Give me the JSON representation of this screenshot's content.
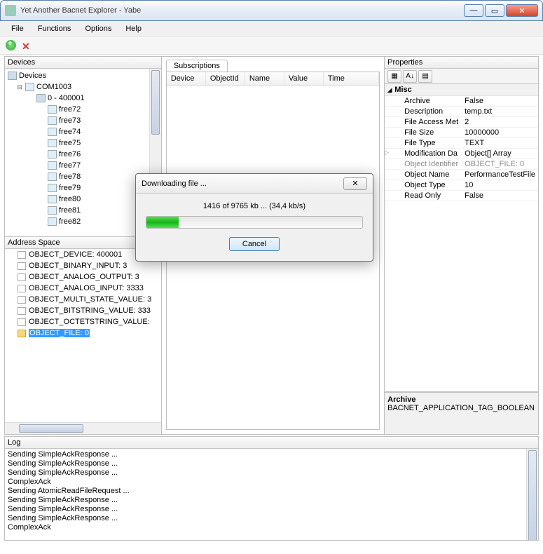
{
  "window": {
    "title": "Yet Another Bacnet Explorer - Yabe"
  },
  "menu": {
    "file": "File",
    "functions": "Functions",
    "options": "Options",
    "help": "Help"
  },
  "panels": {
    "devices": "Devices",
    "address_space": "Address Space",
    "subscriptions": "Subscriptions",
    "properties": "Properties",
    "log": "Log"
  },
  "device_tree": {
    "root": "Devices",
    "port": "COM1003",
    "first": "0 - 400001",
    "free": [
      "free72",
      "free73",
      "free74",
      "free75",
      "free76",
      "free77",
      "free78",
      "free79",
      "free80",
      "free81",
      "free82"
    ]
  },
  "address_space": {
    "items": [
      "OBJECT_DEVICE: 400001",
      "OBJECT_BINARY_INPUT: 3",
      "OBJECT_ANALOG_OUTPUT: 3",
      "OBJECT_ANALOG_INPUT: 3333",
      "OBJECT_MULTI_STATE_VALUE: 3",
      "OBJECT_BITSTRING_VALUE: 333",
      "OBJECT_OCTETSTRING_VALUE:"
    ],
    "selected": "OBJECT_FILE: 0"
  },
  "subs_cols": {
    "device": "Device",
    "objectid": "ObjectId",
    "name": "Name",
    "value": "Value",
    "time": "Time"
  },
  "properties": {
    "category": "Misc",
    "rows": [
      {
        "k": "Archive",
        "v": "False"
      },
      {
        "k": "Description",
        "v": "temp.txt"
      },
      {
        "k": "File Access Met",
        "v": "2"
      },
      {
        "k": "File Size",
        "v": "10000000"
      },
      {
        "k": "File Type",
        "v": "TEXT"
      },
      {
        "k": "Modification Da",
        "v": "Object[] Array",
        "expand": true
      },
      {
        "k": "Object Identifier",
        "v": "OBJECT_FILE: 0",
        "dim": true
      },
      {
        "k": "Object Name",
        "v": "PerformanceTestFile"
      },
      {
        "k": "Object Type",
        "v": "10"
      },
      {
        "k": "Read Only",
        "v": "False"
      }
    ],
    "desc_title": "Archive",
    "desc_value": "BACNET_APPLICATION_TAG_BOOLEAN"
  },
  "log": [
    "Sending SimpleAckResponse ...",
    "Sending SimpleAckResponse ...",
    "Sending SimpleAckResponse ...",
    "ComplexAck",
    "Sending AtomicReadFileRequest ...",
    "Sending SimpleAckResponse ...",
    "Sending SimpleAckResponse ...",
    "Sending SimpleAckResponse ...",
    "ComplexAck"
  ],
  "dialog": {
    "title": "Downloading file ...",
    "status": "1416 of 9765 kb ... (34,4 kb/s)",
    "cancel": "Cancel"
  }
}
